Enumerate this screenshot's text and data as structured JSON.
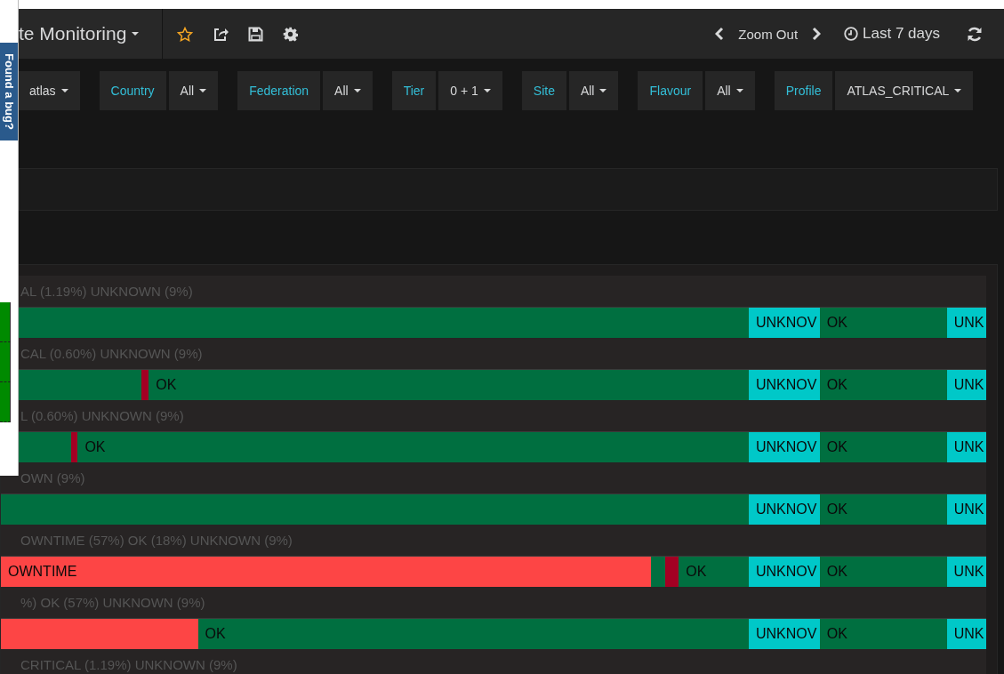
{
  "navbar": {
    "title": "te Monitoring",
    "zoom_out": "Zoom Out",
    "time_range": "Last 7 days"
  },
  "variables": [
    {
      "value": "atlas"
    },
    {
      "label": "Country",
      "value": "All"
    },
    {
      "label": "Federation",
      "value": "All"
    },
    {
      "label": "Tier",
      "value": "0 + 1"
    },
    {
      "label": "Site",
      "value": "All"
    },
    {
      "label": "Flavour",
      "value": "All"
    },
    {
      "label": "Profile",
      "value": "ATLAS_CRITICAL"
    }
  ],
  "timeline_rows": [
    {
      "summary": "AL (1.19%) UNKNOWN (9%)",
      "segments": [
        {
          "kind": "ok"
        },
        {
          "kind": "unknown",
          "label": "UNKNOV"
        },
        {
          "kind": "ok",
          "label": "OK"
        },
        {
          "kind": "unknown",
          "label": "UNK"
        }
      ]
    },
    {
      "summary": "CAL (0.60%) UNKNOWN (9%)",
      "segments": [
        {
          "kind": "ok"
        },
        {
          "kind": "critical"
        },
        {
          "kind": "ok",
          "label": "OK"
        },
        {
          "kind": "unknown",
          "label": "UNKNOV"
        },
        {
          "kind": "ok",
          "label": "OK"
        },
        {
          "kind": "unknown",
          "label": "UNK"
        }
      ]
    },
    {
      "summary": "L (0.60%) UNKNOWN (9%)",
      "segments": [
        {
          "kind": "ok"
        },
        {
          "kind": "critical"
        },
        {
          "kind": "ok",
          "label": "OK"
        },
        {
          "kind": "unknown",
          "label": "UNKNOV"
        },
        {
          "kind": "ok",
          "label": "OK"
        },
        {
          "kind": "unknown",
          "label": "UNK"
        }
      ]
    },
    {
      "summary": "OWN (9%)",
      "segments": [
        {
          "kind": "ok"
        },
        {
          "kind": "unknown",
          "label": "UNKNOV"
        },
        {
          "kind": "ok",
          "label": "OK"
        },
        {
          "kind": "unknown",
          "label": "UNK"
        }
      ]
    },
    {
      "summary": "OWNTIME (57%) OK (18%) UNKNOWN (9%)",
      "segments": [
        {
          "kind": "downtime",
          "label": "OWNTIME"
        },
        {
          "kind": "ok"
        },
        {
          "kind": "critical"
        },
        {
          "kind": "ok",
          "label": "OK"
        },
        {
          "kind": "unknown",
          "label": "UNKNOV"
        },
        {
          "kind": "ok",
          "label": "OK"
        },
        {
          "kind": "unknown",
          "label": "UNK"
        }
      ]
    },
    {
      "summary": "%) OK (57%) UNKNOWN (9%)",
      "segments": [
        {
          "kind": "downtime"
        },
        {
          "kind": "ok",
          "label": "OK"
        },
        {
          "kind": "unknown",
          "label": "UNKNOV"
        },
        {
          "kind": "ok",
          "label": "OK"
        },
        {
          "kind": "unknown",
          "label": "UNK"
        }
      ]
    },
    {
      "summary": "CRITICAL (1.19%) UNKNOWN (9%)",
      "segments": []
    }
  ],
  "feedback_panel": {
    "tab": "Found a bug?",
    "cells": [
      {
        "kind": "ok"
      },
      {
        "kind": "ok"
      },
      {
        "kind": "ok"
      }
    ]
  }
}
